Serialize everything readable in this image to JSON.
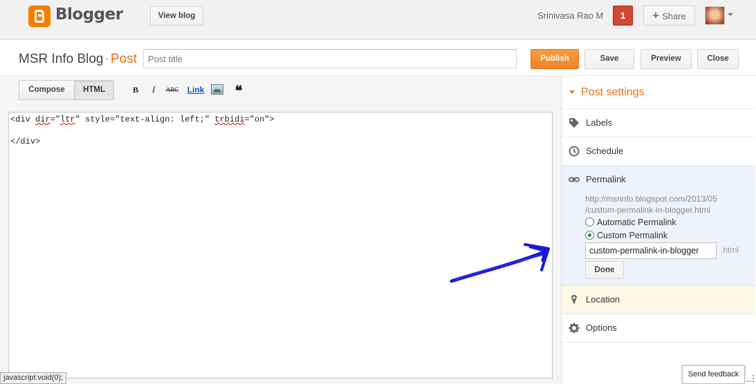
{
  "header": {
    "brand": "Blogger",
    "view_blog": "View blog",
    "user_name": "Srinivasa Rao M",
    "notification_count": "1",
    "share_label": "Share"
  },
  "title_row": {
    "blog_name": "MSR Info Blog",
    "separator": "·",
    "section": "Post",
    "post_title_placeholder": "Post title",
    "publish": "Publish",
    "save": "Save",
    "preview": "Preview",
    "close": "Close"
  },
  "toolbar": {
    "compose": "Compose",
    "html": "HTML",
    "bold": "B",
    "italic": "I",
    "strike": "ABC",
    "link": "Link",
    "quote": "❝"
  },
  "editor": {
    "line1_a": "<div ",
    "line1_b": "dir",
    "line1_c": "=\"",
    "line1_d": "ltr",
    "line1_e": "\" style=\"text-align: left;\" ",
    "line1_f": "trbidi",
    "line1_g": "=\"on\">",
    "line3": "</div>"
  },
  "status_bar": "javascript:void(0);",
  "sidebar": {
    "title": "Post settings",
    "labels": "Labels",
    "schedule": "Schedule",
    "permalink": {
      "label": "Permalink",
      "url_line1": "http://msrinfo.blogspot.com/2013/05",
      "url_line2": "/custom-permalink-in-blogger.html",
      "automatic": "Automatic Permalink",
      "custom": "Custom Permalink",
      "selected": "Custom Permalink",
      "custom_value": "custom-permalink-in-blogger",
      "suffix": ".html",
      "done": "Done"
    },
    "location": "Location",
    "options": "Options"
  },
  "feedback": "Send feedback",
  "colors": {
    "accent": "#e3731e",
    "publish": "#f0832a",
    "notification": "#d14836",
    "annotation_arrow": "#1a1ad6"
  }
}
